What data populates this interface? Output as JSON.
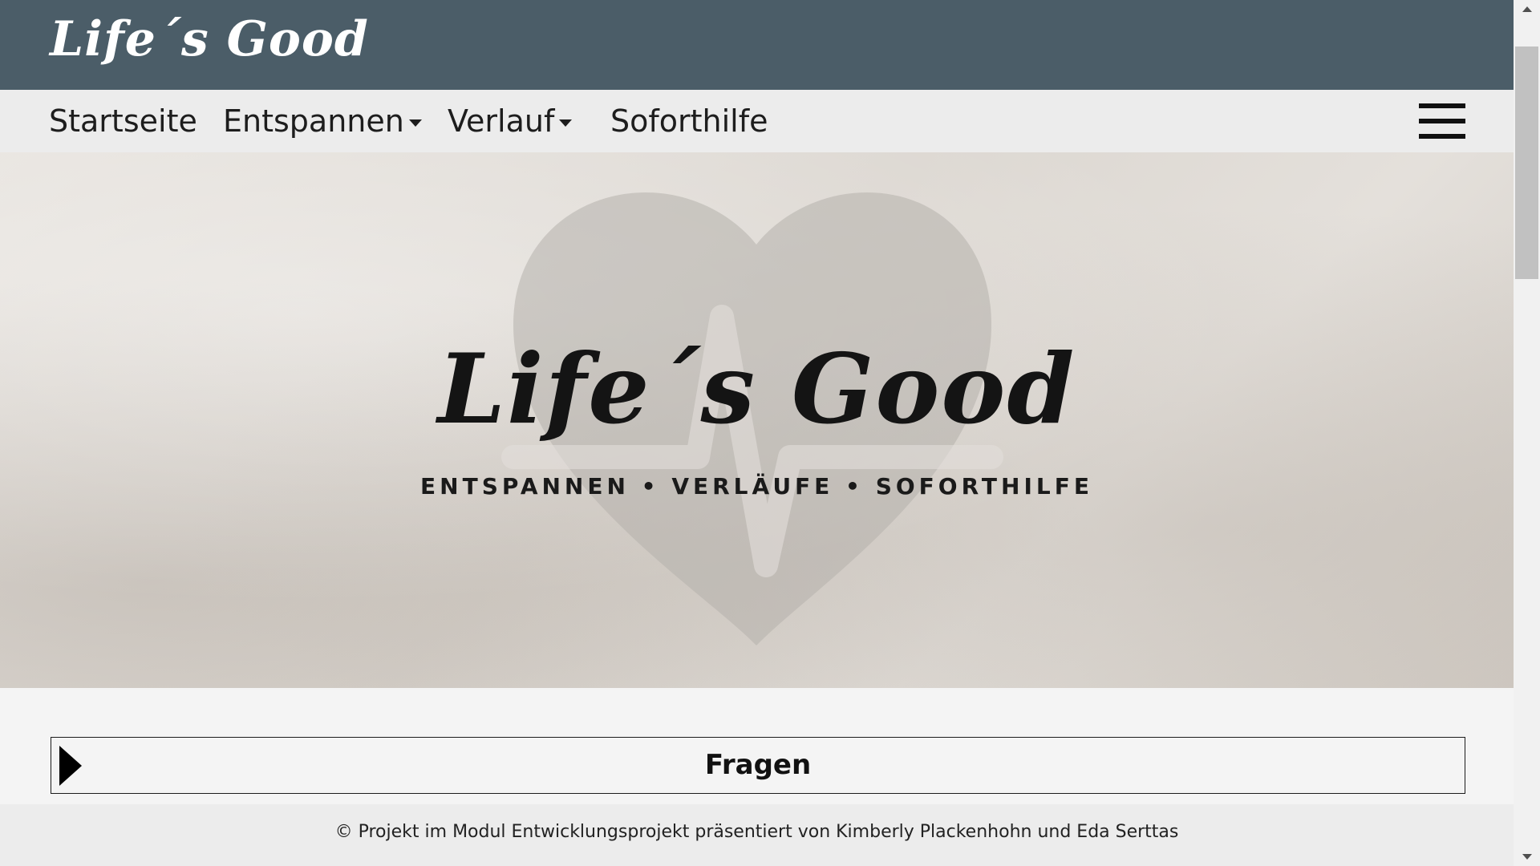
{
  "header": {
    "brand": "Life´s Good"
  },
  "nav": {
    "items": [
      {
        "label": "Startseite",
        "has_dropdown": false
      },
      {
        "label": "Entspannen",
        "has_dropdown": true
      },
      {
        "label": "Verlauf",
        "has_dropdown": true
      },
      {
        "label": "Soforthilfe",
        "has_dropdown": false
      }
    ],
    "menu_icon": "hamburger-menu-icon"
  },
  "hero": {
    "title": "Life´s Good",
    "tagline": "ENTSPANNEN • VERLÄUFE • SOFORTHILFE",
    "background_icon": "heart-pulse-icon"
  },
  "accordion": {
    "label": "Fragen",
    "icon": "triangle-right-icon"
  },
  "footer": {
    "text": "© Projekt im Modul Entwicklungsprojekt präsentiert von Kimberly Plackenhohn und Eda Serttas"
  },
  "colors": {
    "header_bg": "#4b5d68",
    "nav_bg": "#ececec",
    "page_bg": "#f4f4f4"
  }
}
